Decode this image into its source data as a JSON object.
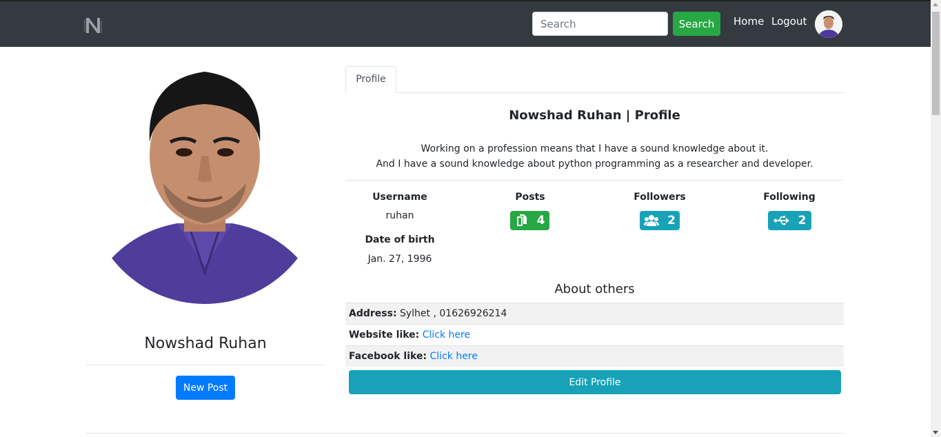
{
  "navbar": {
    "logo_alt": "N",
    "search_placeholder": "Search",
    "search_button": "Search",
    "home": "Home",
    "logout": "Logout"
  },
  "sidebar": {
    "name": "Nowshad Ruhan",
    "new_post": "New Post"
  },
  "tabs": [
    {
      "label": "Profile"
    }
  ],
  "profile": {
    "heading": "Nowshad Ruhan | Profile",
    "bio_line1": "Working on a profession means that I have a sound knowledge about it.",
    "bio_line2": "And I have a sound knowledge about python programming as a researcher and developer."
  },
  "stats": {
    "username_label": "Username",
    "username": "ruhan",
    "posts_label": "Posts",
    "posts": "4",
    "followers_label": "Followers",
    "followers": "2",
    "following_label": "Following",
    "following": "2",
    "dob_label": "Date of birth",
    "dob": "Jan. 27, 1996"
  },
  "about": {
    "heading": "About others",
    "address_label": "Address:",
    "address": "Sylhet , 01626926214",
    "website_label": "Website like:",
    "website_link": "Click here",
    "facebook_label": "Facebook like:",
    "facebook_link": "Click here"
  },
  "edit_profile": "Edit Profile",
  "colors": {
    "navbar": "#343a40",
    "success": "#28a745",
    "info": "#17a2b8",
    "primary": "#007bff"
  }
}
